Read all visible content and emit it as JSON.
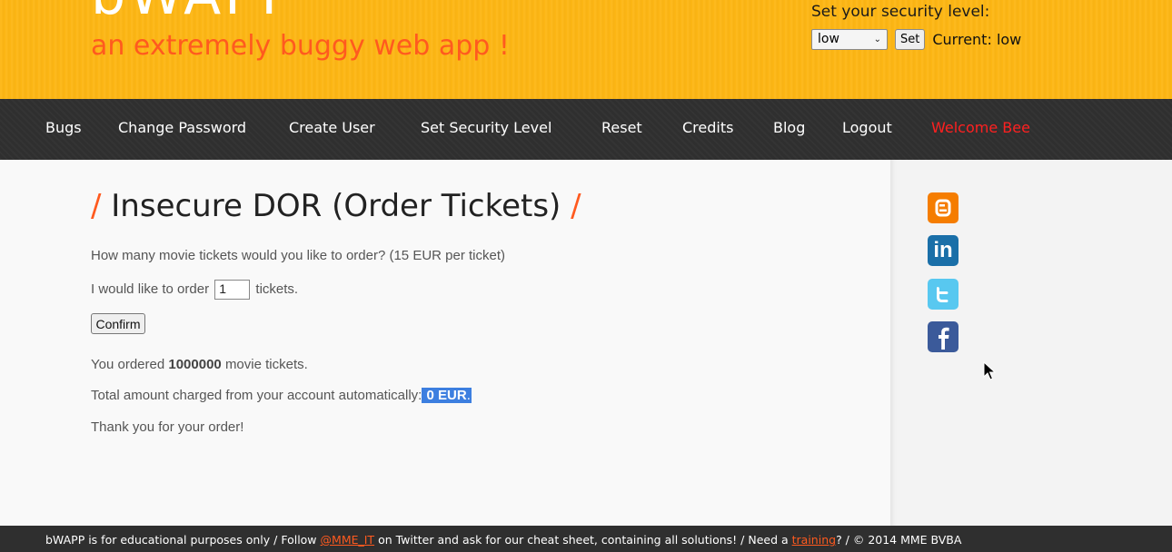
{
  "header": {
    "logo": "bWAPP",
    "tagline": "an extremely buggy web app !",
    "security": {
      "title": "Set your security level:",
      "selected": "low",
      "set_label": "Set",
      "current_label": "Current:",
      "current_value": "low"
    }
  },
  "menu": {
    "items": [
      {
        "label": "Bugs"
      },
      {
        "label": "Change Password"
      },
      {
        "label": "Create User"
      },
      {
        "label": "Set Security Level"
      },
      {
        "label": "Reset"
      },
      {
        "label": "Credits"
      },
      {
        "label": "Blog"
      },
      {
        "label": "Logout"
      },
      {
        "label": "Welcome Bee"
      }
    ]
  },
  "main": {
    "title_slash": "/",
    "title": "Insecure DOR (Order Tickets)",
    "question": "How many movie tickets would you like to order? (15 EUR per ticket)",
    "order_prefix": "I would like to order",
    "order_value": "1",
    "order_suffix": "tickets.",
    "confirm_label": "Confirm",
    "result_prefix": "You ordered",
    "result_count": "1000000",
    "result_suffix": "movie tickets.",
    "total_prefix": "Total amount charged from your account automatically:",
    "total_value": " 0 EUR",
    "total_dot": ".",
    "thanks": "Thank you for your order!"
  },
  "sidebar": {
    "icons": [
      "blogger-icon",
      "linkedin-icon",
      "twitter-icon",
      "facebook-icon"
    ],
    "linkedin_text": "in"
  },
  "footer": {
    "part1": "bWAPP is for educational purposes only / Follow",
    "twitter_link": "@MME_IT",
    "part2": "on Twitter and ask for our cheat sheet, containing all solutions! / Need a",
    "training_link": "training",
    "part3": "? / © 2014 MME BVBA"
  },
  "colors": {
    "header_bg": "#fdb614",
    "accent_orange": "#ff5a1f",
    "menu_bg": "#2f2f2f",
    "welcome_red": "#ff2020",
    "selection_blue": "#3d7fe0"
  }
}
